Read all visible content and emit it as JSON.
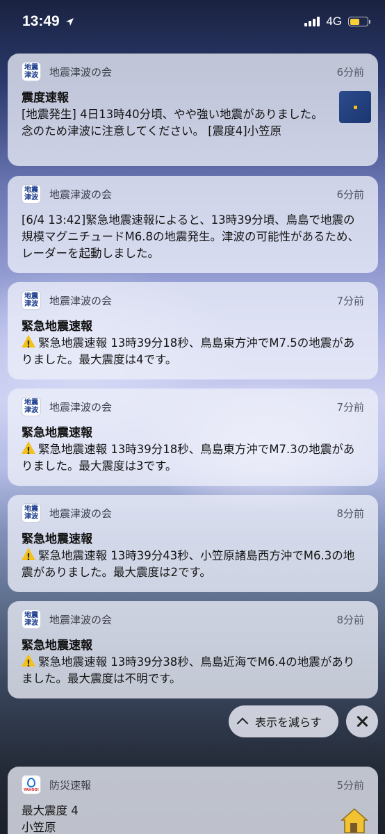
{
  "status_bar": {
    "time": "13:49",
    "network": "4G"
  },
  "notifications": [
    {
      "app": "地震津波の会",
      "icon_lines": [
        "地震",
        "津波"
      ],
      "age": "6分前",
      "title": "震度速報",
      "body": "[地震発生] 4日13時40分頃、やや強い地震がありました。念のため津波に注意してください。 [震度4]小笠原",
      "has_thumbnail": true
    },
    {
      "app": "地震津波の会",
      "icon_lines": [
        "地震",
        "津波"
      ],
      "age": "6分前",
      "title": "",
      "body": "[6/4 13:42]緊急地震速報によると、13時39分頃、鳥島で地震の規模マグニチュードM6.8の地震発生。津波の可能性があるため、レーダーを起動しました。"
    },
    {
      "app": "地震津波の会",
      "icon_lines": [
        "地震",
        "津波"
      ],
      "age": "7分前",
      "title": "緊急地震速報",
      "body": "緊急地震速報 13時39分18秒、鳥島東方沖でM7.5の地震がありました。最大震度は4です。",
      "warning_icon": "warning-icon"
    },
    {
      "app": "地震津波の会",
      "icon_lines": [
        "地震",
        "津波"
      ],
      "age": "7分前",
      "title": "緊急地震速報",
      "body": "緊急地震速報 13時39分18秒、鳥島東方沖でM7.3の地震がありました。最大震度は3です。",
      "warning_icon": "warning-icon"
    },
    {
      "app": "地震津波の会",
      "icon_lines": [
        "地震",
        "津波"
      ],
      "age": "8分前",
      "title": "緊急地震速報",
      "body": "緊急地震速報 13時39分43秒、小笠原諸島西方沖でM6.3の地震がありました。最大震度は2です。",
      "warning_icon": "warning-icon"
    },
    {
      "app": "地震津波の会",
      "icon_lines": [
        "地震",
        "津波"
      ],
      "age": "8分前",
      "title": "緊急地震速報",
      "body": "緊急地震速報 13時39分38秒、鳥島近海でM6.4の地震がありました。最大震度は不明です。",
      "warning_icon": "warning-icon"
    }
  ],
  "controls": {
    "show_less": "表示を減らす"
  },
  "bousai": {
    "app": "防災速報",
    "icon_text": "YAHOO!",
    "age": "5分前",
    "line1": "最大震度 4",
    "line2": "小笠原"
  }
}
